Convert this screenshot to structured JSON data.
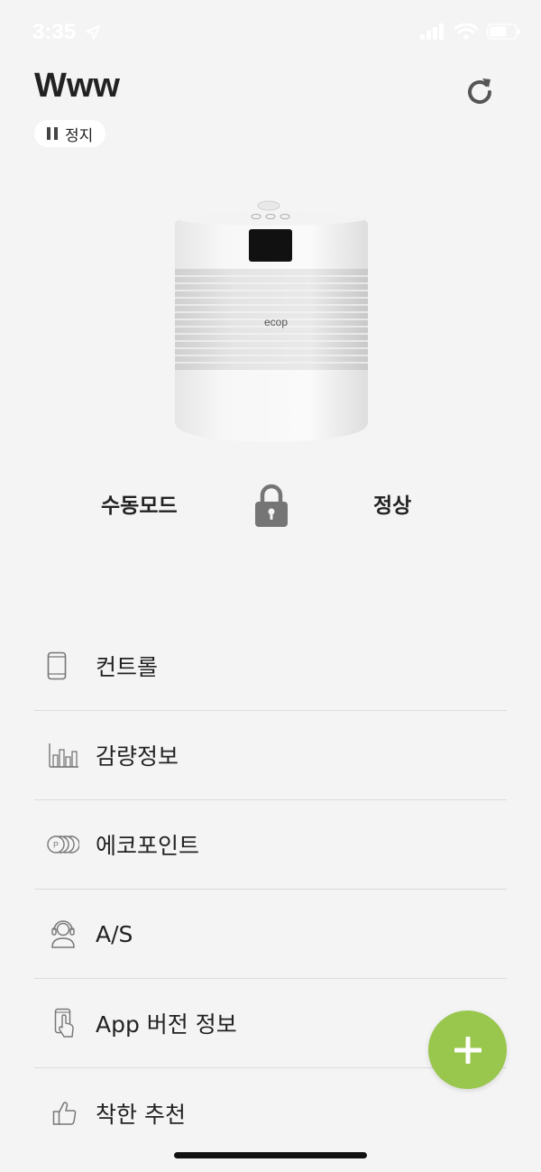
{
  "status_bar": {
    "time": "3:35",
    "location_icon": "location-arrow-icon",
    "signal_icon": "cellular-signal-icon",
    "wifi_icon": "wifi-icon",
    "battery_icon": "battery-icon"
  },
  "header": {
    "title": "Www",
    "refresh_icon": "refresh-icon",
    "status_label": "정지",
    "status_icon": "pause-icon"
  },
  "device": {
    "brand_text": "ecop",
    "mode": "수동모드",
    "lock_icon": "lock-icon",
    "state": "정상"
  },
  "menu": {
    "items": [
      {
        "label": "컨트롤",
        "icon": "phone-icon"
      },
      {
        "label": "감량정보",
        "icon": "bar-chart-icon"
      },
      {
        "label": "에코포인트",
        "icon": "coin-stack-icon"
      },
      {
        "label": "A/S",
        "icon": "headset-agent-icon"
      },
      {
        "label": "App 버전 정보",
        "icon": "phone-tap-icon"
      },
      {
        "label": "착한 추천",
        "icon": "thumbs-up-icon"
      }
    ]
  },
  "fab": {
    "icon": "plus-icon"
  },
  "colors": {
    "background": "#f4f4f4",
    "accent_green": "#99c64c",
    "text": "#222222",
    "divider": "#dcdcdc"
  }
}
